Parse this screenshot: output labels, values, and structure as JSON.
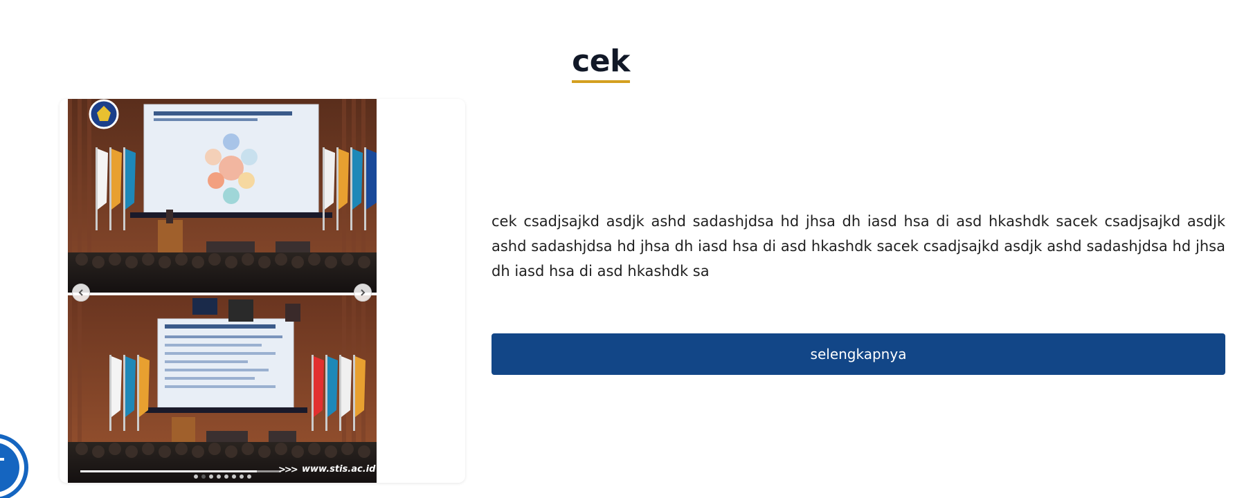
{
  "section": {
    "title": "cek",
    "description": "cek csadjsajkd asdjk ashd sadashjdsa hd jhsa dh iasd hsa di asd hkashdk sacek csadjsajkd asdjk ashd sadashjdsa hd jhsa dh iasd hsa di asd hkashdk sacek csadjsajkd asdjk ashd sadashjdsa hd jhsa dh iasd hsa di asd hkashdk sa",
    "button_label": "selengkapnya"
  },
  "carousel": {
    "image_description": "event photo collage: seminar hall with flags, stage presenter and projection screen",
    "watermark_url": "www.stis.ac.id",
    "watermark_arrows": ">>>",
    "logo_text": "STIS",
    "prev_icon": "chevron-left-icon",
    "next_icon": "chevron-right-icon",
    "total_slides": 8,
    "active_slide": 2,
    "progress_fraction": 0.88
  },
  "colors": {
    "accent_underline": "#d4a020",
    "button_bg": "#124687",
    "fab_ring": "#1565c0"
  },
  "fab": {
    "icon": "chat-icon"
  }
}
